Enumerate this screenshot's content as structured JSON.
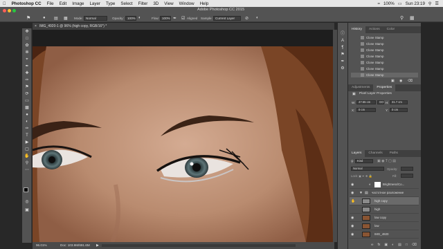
{
  "menubar": {
    "app": "Photoshop CC",
    "items": [
      "File",
      "Edit",
      "Image",
      "Layer",
      "Type",
      "Select",
      "Filter",
      "3D",
      "View",
      "Window",
      "Help"
    ],
    "battery": "100%",
    "clock": "Sun 23:19"
  },
  "window": {
    "title": "Adobe Photoshop CC 2015"
  },
  "options": {
    "mode_label": "Mode:",
    "mode_value": "Normal",
    "opacity_label": "Opacity:",
    "opacity_value": "100%",
    "flow_label": "Flow:",
    "flow_value": "100%",
    "aligned_label": "Aligned",
    "sample_label": "Sample:",
    "sample_value": "Current Layer"
  },
  "document": {
    "tab_label": "IMG_4920-1 @ 96% (high copy, RGB/16*) *",
    "status_zoom": "96.01%",
    "status_doc": "Doc: 103.9M/691.6M"
  },
  "history": {
    "tabs": [
      "History",
      "Actions",
      "Color"
    ],
    "items": [
      "Clone Stamp",
      "Clone Stamp",
      "Clone Stamp",
      "Clone Stamp",
      "Clone Stamp",
      "Clone Stamp",
      "Clone Stamp"
    ]
  },
  "properties": {
    "tabs": [
      "Adjustments",
      "Properties"
    ],
    "title": "Pixel Layer Properties",
    "w_label": "W:",
    "w_value": "47.55 cm",
    "h_label": "H:",
    "h_value": "31.7 cm",
    "link": "GO",
    "x_label": "X:",
    "x_value": "0 cm",
    "y_label": "Y:",
    "y_value": "0 cm"
  },
  "layers": {
    "tabs": [
      "Layers",
      "Channels",
      "Paths"
    ],
    "kind_label": "Kind",
    "blend_value": "Normal",
    "opacity_label": "Opacity:",
    "fill_label": "Fill:",
    "items": [
      {
        "name": "Brightness/Co..."
      },
      {
        "name": "частотное разложение"
      },
      {
        "name": "high copy"
      },
      {
        "name": "high"
      },
      {
        "name": "low copy"
      },
      {
        "name": "low"
      },
      {
        "name": "IMG_4920"
      }
    ]
  },
  "colors": {
    "ui_dark": "#535353",
    "menu_bg": "#e6e6e6",
    "skin": "#c49a80"
  }
}
